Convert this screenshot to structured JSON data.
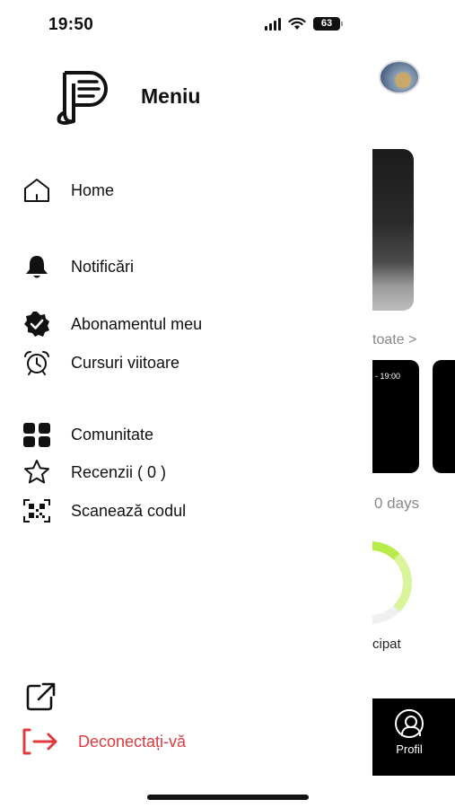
{
  "status_bar": {
    "time": "19:50",
    "battery": "63"
  },
  "menu": {
    "title": "Meniu",
    "items": [
      {
        "id": "home",
        "label": "Home",
        "icon": "home-icon"
      },
      {
        "id": "notifications",
        "label": "Notificări",
        "icon": "bell-icon"
      },
      {
        "id": "subscription",
        "label": "Abonamentul meu",
        "icon": "verified-badge-icon"
      },
      {
        "id": "upcoming",
        "label": "Cursuri viitoare",
        "icon": "alarm-clock-icon"
      },
      {
        "id": "community",
        "label": "Comunitate",
        "icon": "grid-icon"
      },
      {
        "id": "reviews",
        "label": "Recenzii ( 0 )",
        "icon": "star-icon"
      },
      {
        "id": "scan",
        "label": "Scanează codul",
        "icon": "qr-code-icon"
      }
    ],
    "external_link_icon": "external-link-icon",
    "logout": {
      "label": "Deconectați-vă",
      "icon": "logout-icon",
      "color": "#e0393e"
    }
  },
  "background_app": {
    "see_all_fragment": "toate >",
    "card_time_fragment": "- 19:00",
    "days_fragment": "0 days",
    "participated_fragment": "cipat",
    "tab_profile_label": "Profil",
    "accent_color": "#b7ec4a"
  }
}
